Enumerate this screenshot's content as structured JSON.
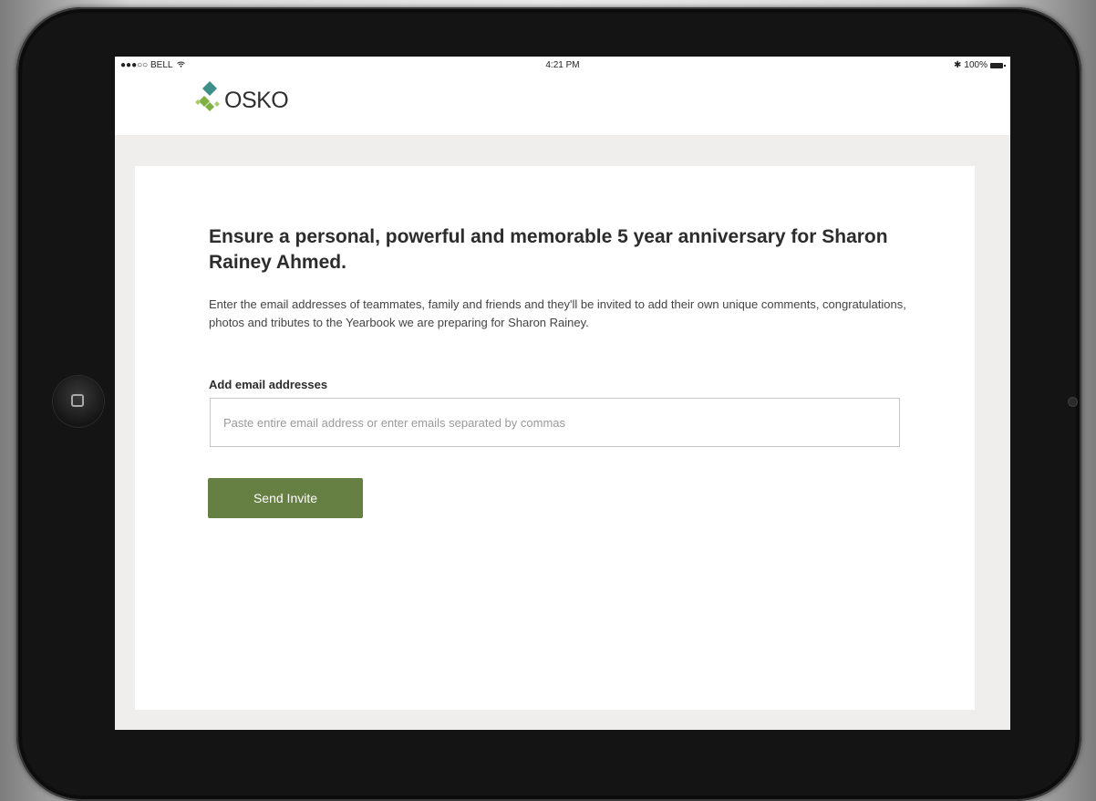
{
  "status_bar": {
    "carrier": "●●●○○ BELL",
    "wifi_icon": "wifi-icon",
    "time": "4:21 PM",
    "bluetooth": "✱",
    "battery": "100%"
  },
  "header": {
    "logo_text": "OSKO",
    "colors": {
      "teal": "#3d8f8a",
      "green": "#7fb043",
      "light_green": "#a9cc6a"
    }
  },
  "main": {
    "headline": "Ensure a personal, powerful and memorable 5 year anniversary for Sharon Rainey Ahmed.",
    "description": "Enter the email addresses of teammates, family and friends and they'll be invited to add their own unique comments, congratulations, photos and tributes to the Yearbook we are preparing for Sharon Rainey.",
    "email_label": "Add email addresses",
    "email_value": "",
    "email_placeholder": "Paste entire email address or enter emails separated by commas",
    "send_label": "Send Invite",
    "accent": "#667f42"
  }
}
